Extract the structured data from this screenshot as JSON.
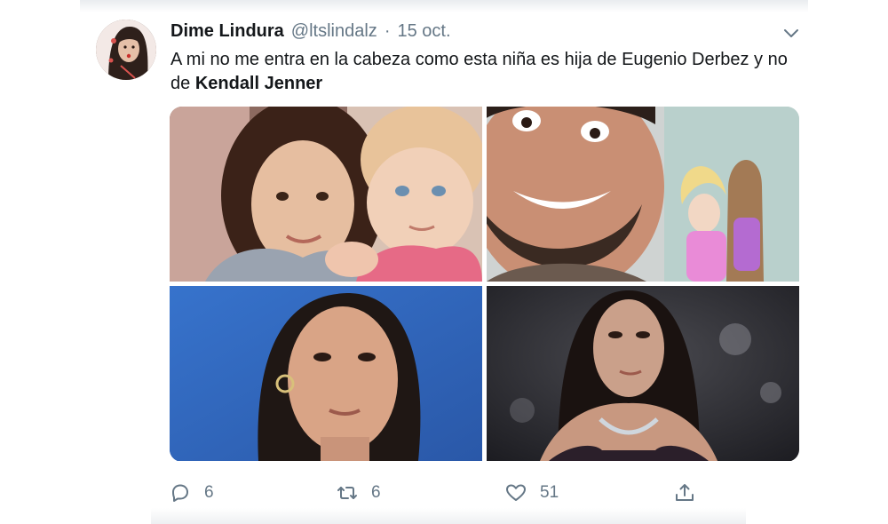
{
  "tweet": {
    "author": {
      "display_name": "Dime Lindura",
      "handle": "@ltslindalz",
      "avatar_icon": "user-avatar"
    },
    "separator": "·",
    "timestamp": "15 oct.",
    "text_prefix": "A mi no me entra en la cabeza como esta niña es hija de Eugenio Derbez y no de ",
    "text_bold": "Kendall Jenner",
    "media": [
      {
        "description_icon": "photo-two-children"
      },
      {
        "description_icon": "photo-man-selfie-with-dolls"
      },
      {
        "description_icon": "photo-woman-portrait-blue"
      },
      {
        "description_icon": "photo-woman-portrait-dark"
      }
    ],
    "actions": {
      "reply_count": "6",
      "retweet_count": "6",
      "like_count": "51"
    }
  },
  "colors": {
    "text": "#14171a",
    "muted": "#657786",
    "background": "#ffffff"
  }
}
